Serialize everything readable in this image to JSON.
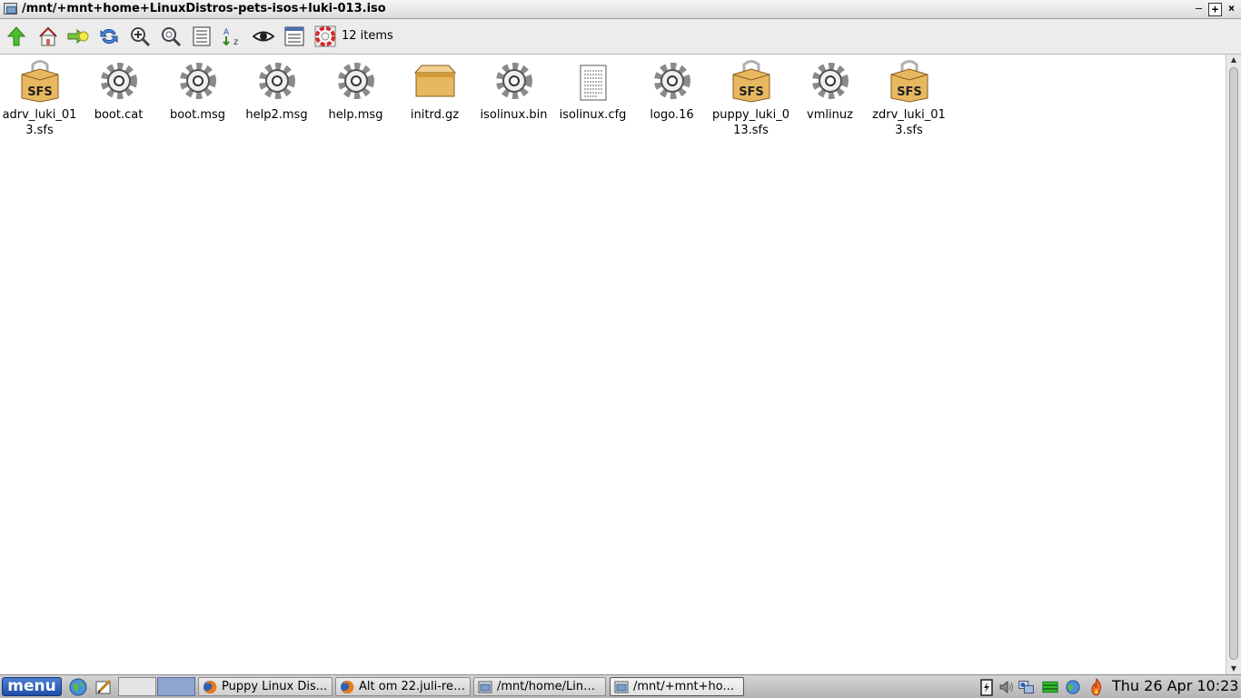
{
  "window": {
    "title": "/mnt/+mnt+home+LinuxDistros-pets-isos+luki-013.iso",
    "minimize_label": "–",
    "maximize_label": "+",
    "close_label": "×"
  },
  "toolbar": {
    "buttons": [
      {
        "name": "up",
        "icon": "up-arrow-icon"
      },
      {
        "name": "home",
        "icon": "home-icon"
      },
      {
        "name": "bookmarks",
        "icon": "bookmarks-icon"
      },
      {
        "name": "refresh",
        "icon": "refresh-icon"
      },
      {
        "name": "zoom-in",
        "icon": "zoom-in-icon"
      },
      {
        "name": "zoom-fit",
        "icon": "zoom-fit-icon"
      },
      {
        "name": "details-view",
        "icon": "details-view-icon"
      },
      {
        "name": "sort",
        "icon": "sort-az-icon"
      },
      {
        "name": "show-hidden",
        "icon": "eye-icon"
      },
      {
        "name": "options",
        "icon": "options-icon"
      },
      {
        "name": "help",
        "icon": "lifebuoy-icon"
      }
    ],
    "item_count": "12 items"
  },
  "files": [
    {
      "name": "adrv_luki_013.sfs",
      "label_line1": "adrv_luki_01",
      "label_line2": "3.sfs",
      "icon": "sfs-package-icon"
    },
    {
      "name": "boot.cat",
      "label_line1": "boot.cat",
      "label_line2": "",
      "icon": "gear-icon"
    },
    {
      "name": "boot.msg",
      "label_line1": "boot.msg",
      "label_line2": "",
      "icon": "gear-icon"
    },
    {
      "name": "help2.msg",
      "label_line1": "help2.msg",
      "label_line2": "",
      "icon": "gear-icon"
    },
    {
      "name": "help.msg",
      "label_line1": "help.msg",
      "label_line2": "",
      "icon": "gear-icon"
    },
    {
      "name": "initrd.gz",
      "label_line1": "initrd.gz",
      "label_line2": "",
      "icon": "archive-box-icon"
    },
    {
      "name": "isolinux.bin",
      "label_line1": "isolinux.bin",
      "label_line2": "",
      "icon": "gear-icon"
    },
    {
      "name": "isolinux.cfg",
      "label_line1": "isolinux.cfg",
      "label_line2": "",
      "icon": "text-file-icon"
    },
    {
      "name": "logo.16",
      "label_line1": "logo.16",
      "label_line2": "",
      "icon": "gear-icon"
    },
    {
      "name": "puppy_luki_013.sfs",
      "label_line1": "puppy_luki_0",
      "label_line2": "13.sfs",
      "icon": "sfs-package-icon"
    },
    {
      "name": "vmlinuz",
      "label_line1": "vmlinuz",
      "label_line2": "",
      "icon": "gear-icon"
    },
    {
      "name": "zdrv_luki_013.sfs",
      "label_line1": "zdrv_luki_01",
      "label_line2": "3.sfs",
      "icon": "sfs-package-icon"
    }
  ],
  "sfs_badge": "SFS",
  "taskbar": {
    "menu_label": "menu",
    "quick_launch": [
      "browser-globe-icon",
      "text-editor-icon"
    ],
    "tasks": [
      {
        "label": "Puppy Linux Dis...",
        "icon": "firefox-icon",
        "active": false
      },
      {
        "label": "Alt om 22.juli-ret...",
        "icon": "firefox-icon",
        "active": false
      },
      {
        "label": "/mnt/home/Linu...",
        "icon": "folder-window-icon",
        "active": false
      },
      {
        "label": "/mnt/+mnt+ho...",
        "icon": "folder-window-icon",
        "active": true
      }
    ],
    "tray_icons": [
      "battery-icon",
      "volume-icon",
      "network-icon",
      "memory-icon",
      "globe-icon",
      "firewall-flame-icon"
    ],
    "clock": "Thu 26 Apr 10:23"
  },
  "colors": {
    "menu_button": "#2a5bb8",
    "sfs_box": "#e8b860",
    "gear": "#9a9a9a"
  }
}
